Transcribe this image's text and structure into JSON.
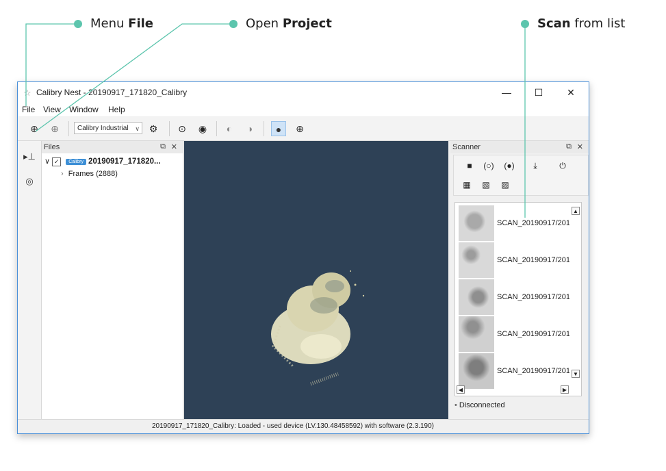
{
  "callouts": {
    "menu_file": {
      "prefix": "Menu ",
      "bold": "File"
    },
    "open_project": {
      "prefix": "Open ",
      "bold": "Project"
    },
    "scan_from_list": {
      "bold": "Scan",
      "suffix": " from list"
    },
    "accent_color": "#5cc5ad"
  },
  "window": {
    "title": "Calibry Nest - 20190917_171820_Calibry",
    "controls": {
      "minimize": "—",
      "maximize": "☐",
      "close": "✕"
    }
  },
  "menu": [
    "File",
    "View",
    "Window",
    "Help"
  ],
  "toolbar": {
    "device_select": "Calibry Industrial"
  },
  "files_panel": {
    "title": "Files",
    "project_badge": "Calibry",
    "project_name": "20190917_171820...",
    "child": "Frames (2888)"
  },
  "scanner_panel": {
    "title": "Scanner",
    "scans": [
      "SCAN_20190917/201",
      "SCAN_20190917/201",
      "SCAN_20190917/201",
      "SCAN_20190917/201",
      "SCAN_20190917/201"
    ],
    "connection_status": "Disconnected"
  },
  "status_bar": "20190917_171820_Calibry: Loaded - used device (LV.130.48458592) with software (2.3.190)",
  "colors": {
    "viewport_bg": "#2e4156",
    "window_border": "#4a90d9",
    "point_cloud": "#e6e3c2"
  }
}
